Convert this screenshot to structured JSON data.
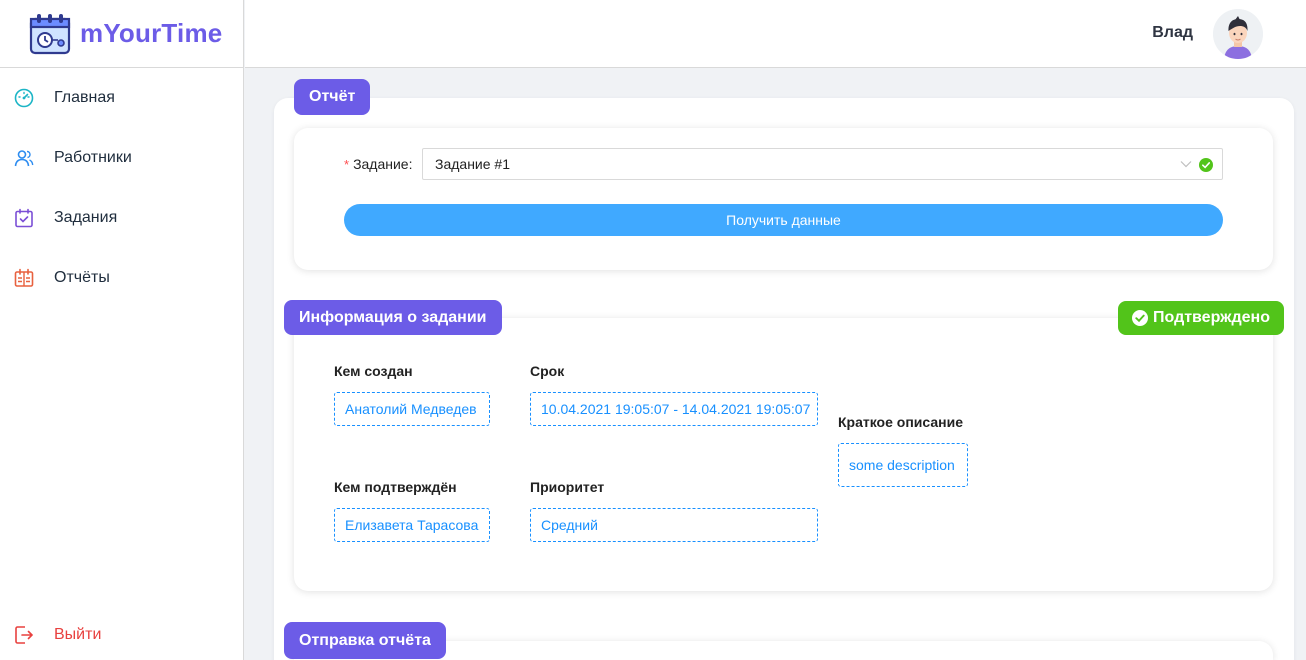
{
  "app": {
    "title": "mYourTime"
  },
  "sidebar": {
    "items": [
      {
        "label": "Главная",
        "icon": "dashboard-icon"
      },
      {
        "label": "Работники",
        "icon": "users-icon"
      },
      {
        "label": "Задания",
        "icon": "calendar-check-icon"
      },
      {
        "label": "Отчёты",
        "icon": "reports-icon"
      }
    ],
    "logout": {
      "label": "Выйти",
      "icon": "logout-icon"
    }
  },
  "header": {
    "user_name": "Влад"
  },
  "report": {
    "section_title": "Отчёт",
    "task_label": "Задание",
    "task_value": "Задание #1",
    "fetch_button": "Получить данные"
  },
  "task_info": {
    "section_title": "Информация о задании",
    "status": "Подтверждено",
    "created_by_label": "Кем создан",
    "created_by": "Анатолий Медведев",
    "deadline_label": "Срок",
    "deadline": "10.04.2021 19:05:07 - 14.04.2021 19:05:07",
    "description_label": "Краткое описание",
    "description": "some description",
    "confirmed_by_label": "Кем подтверждён",
    "confirmed_by": "Елизавета Тарасова",
    "priority_label": "Приоритет",
    "priority": "Средний"
  },
  "send_report": {
    "section_title": "Отправка отчёта"
  },
  "colors": {
    "brand": "#6c5ce7",
    "primary_button": "#40a9ff",
    "success": "#52c41a",
    "danger": "#e8413f",
    "field_accent": "#1890ff"
  }
}
